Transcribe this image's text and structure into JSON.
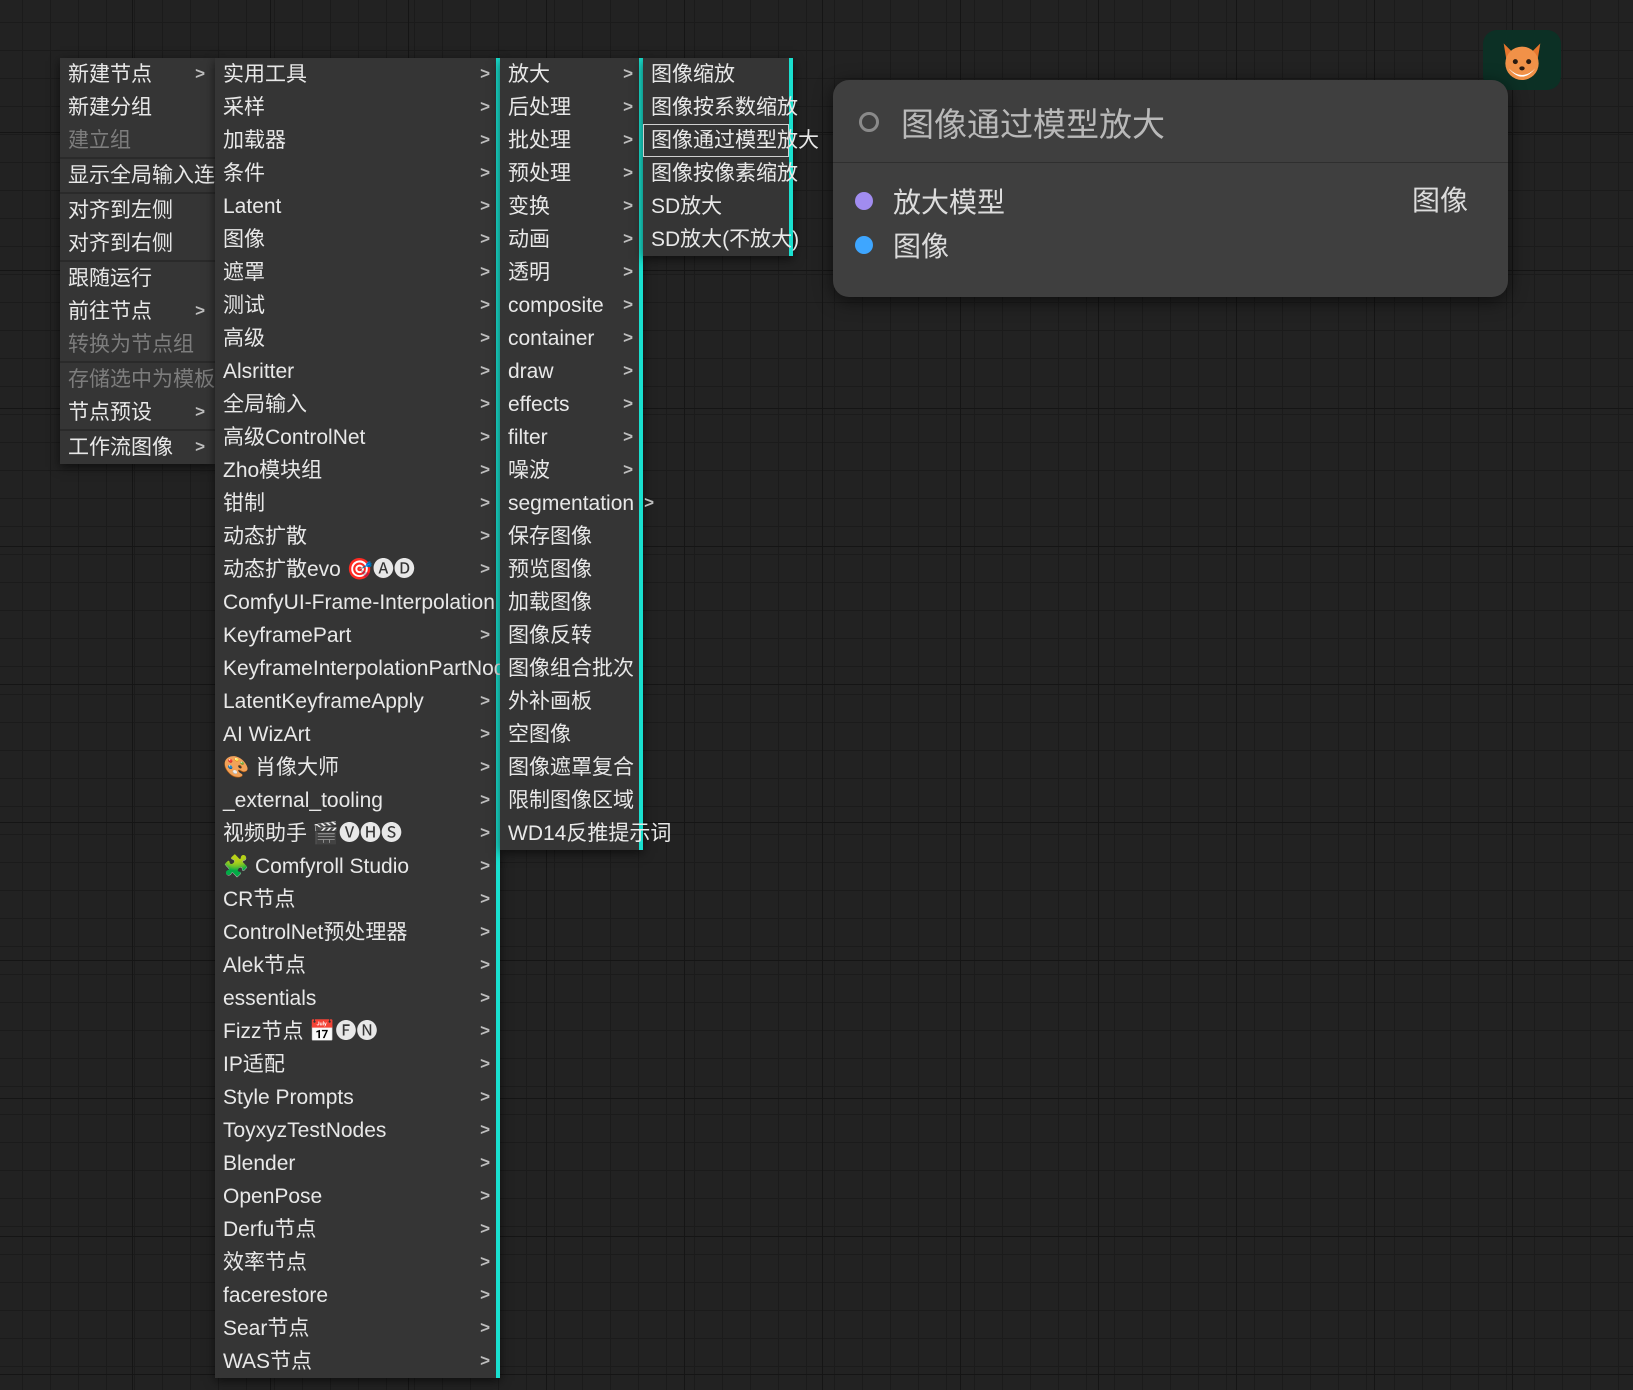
{
  "node": {
    "title": "图像通过模型放大",
    "input1": "放大模型",
    "input2": "图像",
    "output1": "图像"
  },
  "menu": {
    "l1": [
      {
        "label": "新建节点",
        "arrow": true,
        "disabled": false
      },
      {
        "label": "新建分组",
        "arrow": false,
        "disabled": false
      },
      {
        "label": "建立组",
        "arrow": false,
        "disabled": true
      },
      {
        "sep": true
      },
      {
        "label": "显示全局输入连线",
        "arrow": false,
        "disabled": false
      },
      {
        "sep": true
      },
      {
        "label": "对齐到左侧",
        "arrow": false,
        "disabled": false
      },
      {
        "label": "对齐到右侧",
        "arrow": false,
        "disabled": false
      },
      {
        "sep": true
      },
      {
        "label": "跟随运行",
        "arrow": false,
        "disabled": false
      },
      {
        "label": "前往节点",
        "arrow": true,
        "disabled": false
      },
      {
        "label": "转换为节点组",
        "arrow": false,
        "disabled": true
      },
      {
        "sep": true
      },
      {
        "label": "存储选中为模板",
        "arrow": false,
        "disabled": true
      },
      {
        "label": "节点预设",
        "arrow": true,
        "disabled": false
      },
      {
        "sep": true
      },
      {
        "label": "工作流图像",
        "arrow": true,
        "disabled": false
      }
    ],
    "l2": [
      {
        "label": "实用工具",
        "arrow": true
      },
      {
        "label": "采样",
        "arrow": true
      },
      {
        "label": "加载器",
        "arrow": true
      },
      {
        "label": "条件",
        "arrow": true
      },
      {
        "label": "Latent",
        "arrow": true
      },
      {
        "label": "图像",
        "arrow": true
      },
      {
        "label": "遮罩",
        "arrow": true
      },
      {
        "label": "测试",
        "arrow": true
      },
      {
        "label": "高级",
        "arrow": true
      },
      {
        "label": "Alsritter",
        "arrow": true
      },
      {
        "label": "全局输入",
        "arrow": true
      },
      {
        "label": "高级ControlNet",
        "arrow": true
      },
      {
        "label": "Zho模块组",
        "arrow": true
      },
      {
        "label": "钳制",
        "arrow": true
      },
      {
        "label": "动态扩散",
        "arrow": true
      },
      {
        "label": "动态扩散evo 🎯🅐🅓",
        "arrow": true
      },
      {
        "label": "ComfyUI-Frame-Interpolation",
        "arrow": true
      },
      {
        "label": "KeyframePart",
        "arrow": true
      },
      {
        "label": "KeyframeInterpolationPartNode",
        "arrow": true
      },
      {
        "label": "LatentKeyframeApply",
        "arrow": true
      },
      {
        "label": "AI WizArt",
        "arrow": true
      },
      {
        "label": "🎨 肖像大师",
        "arrow": true
      },
      {
        "label": "_external_tooling",
        "arrow": true
      },
      {
        "label": "视频助手 🎬🅥🅗🅢",
        "arrow": true
      },
      {
        "label": "🧩 Comfyroll Studio",
        "arrow": true
      },
      {
        "label": "CR节点",
        "arrow": true
      },
      {
        "label": "ControlNet预处理器",
        "arrow": true
      },
      {
        "label": "Alek节点",
        "arrow": true
      },
      {
        "label": "essentials",
        "arrow": true
      },
      {
        "label": "Fizz节点 📅🅕🅝",
        "arrow": true
      },
      {
        "label": "IP适配",
        "arrow": true
      },
      {
        "label": "Style Prompts",
        "arrow": true
      },
      {
        "label": "ToyxyzTestNodes",
        "arrow": true
      },
      {
        "label": "Blender",
        "arrow": true
      },
      {
        "label": "OpenPose",
        "arrow": true
      },
      {
        "label": "Derfu节点",
        "arrow": true
      },
      {
        "label": "效率节点",
        "arrow": true
      },
      {
        "label": "facerestore",
        "arrow": true
      },
      {
        "label": "Sear节点",
        "arrow": true
      },
      {
        "label": "WAS节点",
        "arrow": true
      }
    ],
    "l3": [
      {
        "label": "放大",
        "arrow": true
      },
      {
        "label": "后处理",
        "arrow": true
      },
      {
        "label": "批处理",
        "arrow": true
      },
      {
        "label": "预处理",
        "arrow": true
      },
      {
        "label": "变换",
        "arrow": true
      },
      {
        "label": "动画",
        "arrow": true
      },
      {
        "label": "透明",
        "arrow": true
      },
      {
        "label": "composite",
        "arrow": true
      },
      {
        "label": "container",
        "arrow": true
      },
      {
        "label": "draw",
        "arrow": true
      },
      {
        "label": "effects",
        "arrow": true
      },
      {
        "label": "filter",
        "arrow": true
      },
      {
        "label": "噪波",
        "arrow": true
      },
      {
        "label": "segmentation",
        "arrow": true
      },
      {
        "label": "保存图像",
        "arrow": false
      },
      {
        "label": "预览图像",
        "arrow": false
      },
      {
        "label": "加载图像",
        "arrow": false
      },
      {
        "label": "图像反转",
        "arrow": false
      },
      {
        "label": "图像组合批次",
        "arrow": false
      },
      {
        "label": "外补画板",
        "arrow": false
      },
      {
        "label": "空图像",
        "arrow": false
      },
      {
        "label": "图像遮罩复合",
        "arrow": false
      },
      {
        "label": "限制图像区域",
        "arrow": false
      },
      {
        "label": "WD14反推提示词",
        "arrow": false
      }
    ],
    "l4": [
      {
        "label": "图像缩放",
        "arrow": false,
        "sel": false
      },
      {
        "label": "图像按系数缩放",
        "arrow": false,
        "sel": false
      },
      {
        "label": "图像通过模型放大",
        "arrow": false,
        "sel": true
      },
      {
        "label": "图像按像素缩放",
        "arrow": false,
        "sel": false
      },
      {
        "label": "SD放大",
        "arrow": false,
        "sel": false
      },
      {
        "label": "SD放大(不放大)",
        "arrow": false,
        "sel": false
      }
    ]
  }
}
